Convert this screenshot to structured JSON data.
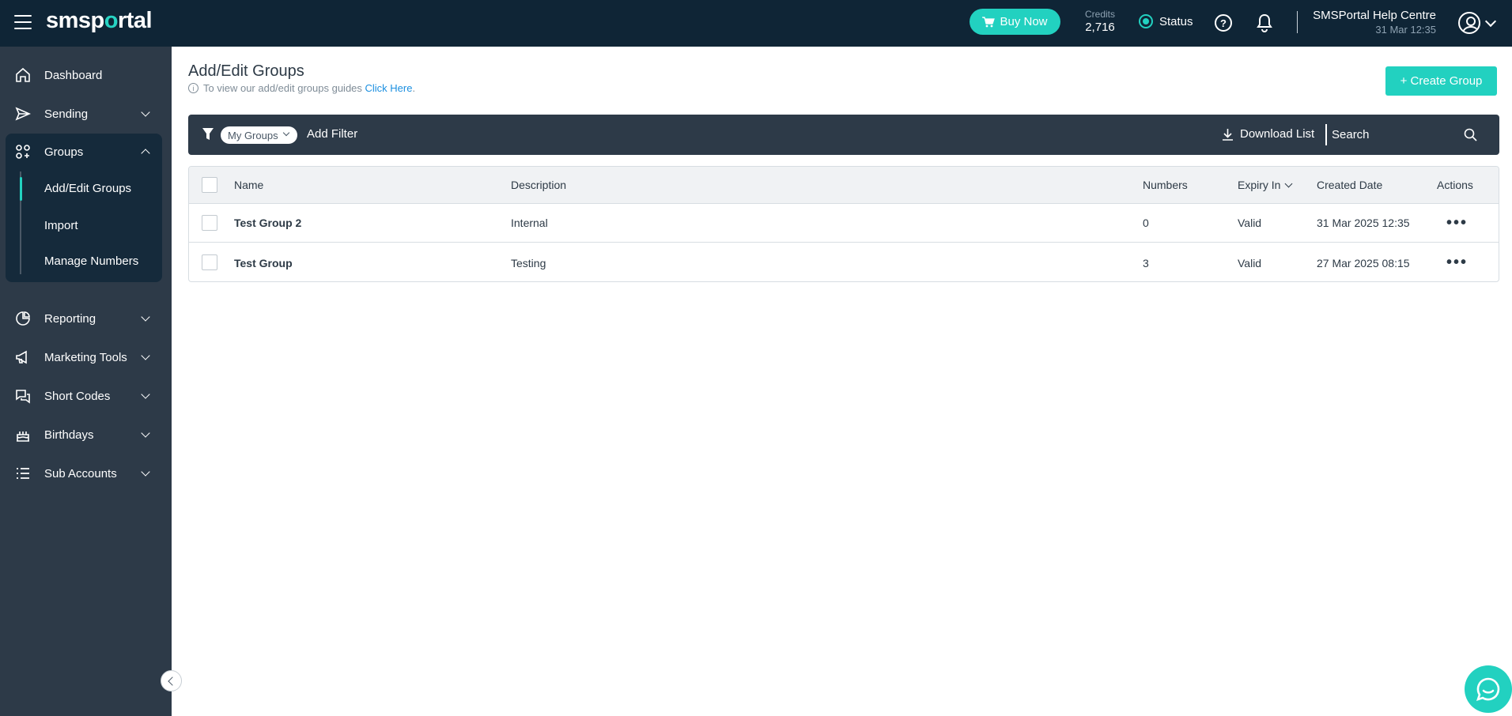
{
  "topbar": {
    "logo_main": "sms",
    "logo_p": "p",
    "logo_o": "o",
    "logo_rest": "rtal",
    "buy_label": "Buy Now",
    "credits_label": "Credits",
    "credits_value": "2,716",
    "status_label": "Status",
    "help_icon": "help-icon",
    "bell_icon": "bell-icon",
    "help_centre_label": "SMSPortal Help Centre",
    "datetime": "31 Mar 12:35"
  },
  "sidebar": {
    "items": [
      {
        "label": "Dashboard",
        "icon": "home-icon"
      },
      {
        "label": "Sending",
        "icon": "send-icon"
      },
      {
        "label": "Groups",
        "icon": "groups-icon"
      },
      {
        "label": "Reporting",
        "icon": "chart-icon"
      },
      {
        "label": "Marketing Tools",
        "icon": "megaphone-icon"
      },
      {
        "label": "Short Codes",
        "icon": "chat-icon"
      },
      {
        "label": "Birthdays",
        "icon": "cake-icon"
      },
      {
        "label": "Sub Accounts",
        "icon": "list-icon"
      }
    ],
    "groups_sub": [
      "Add/Edit Groups",
      "Import",
      "Manage Numbers"
    ]
  },
  "main": {
    "title": "Add/Edit Groups",
    "guide_text": "To view our add/edit groups guides ",
    "guide_link": "Click Here",
    "guide_end": ".",
    "create_label": "+ Create Group"
  },
  "filter": {
    "pill_label": "My Groups",
    "add_filter_label": "Add Filter",
    "download_label": "Download List",
    "search_placeholder": "Search"
  },
  "table": {
    "headers": [
      "Name",
      "Description",
      "Numbers",
      "Expiry In",
      "Created Date",
      "Actions"
    ],
    "rows": [
      {
        "name": "Test Group 2",
        "description": "Internal",
        "numbers": "0",
        "expiry": "Valid",
        "created": "31 Mar 2025 12:35"
      },
      {
        "name": "Test Group",
        "description": "Testing",
        "numbers": "3",
        "expiry": "Valid",
        "created": "27 Mar 2025 08:15"
      }
    ]
  },
  "colors": {
    "topbar": "#0f2536",
    "sidebar": "#2d3a48",
    "accent": "#22d1c0",
    "link": "#1b8fe0"
  }
}
